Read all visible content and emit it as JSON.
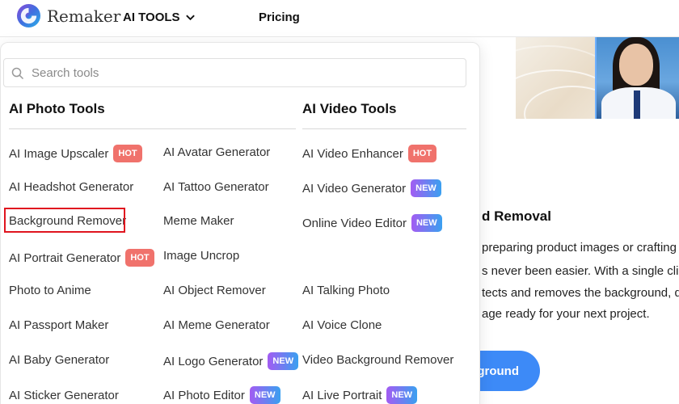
{
  "header": {
    "brand": "Remaker",
    "ai_tools_label": "AI TOOLS",
    "pricing_label": "Pricing"
  },
  "search": {
    "placeholder": "Search tools",
    "value": ""
  },
  "photo_tools": {
    "title": "AI Photo Tools",
    "col1": [
      {
        "label": "AI Image Upscaler",
        "badge": "HOT"
      },
      {
        "label": "AI Headshot Generator"
      },
      {
        "label": "Background Remover"
      },
      {
        "label": "AI Portrait Generator",
        "badge": "HOT"
      },
      {
        "label": "Photo to Anime"
      },
      {
        "label": "AI Passport Maker"
      },
      {
        "label": "AI Baby Generator"
      },
      {
        "label": "AI Sticker Generator"
      }
    ],
    "col2": [
      {
        "label": "AI Avatar Generator"
      },
      {
        "label": "AI Tattoo Generator"
      },
      {
        "label": "Meme Maker"
      },
      {
        "label": "Image Uncrop"
      },
      {
        "label": "AI Object Remover"
      },
      {
        "label": "AI Meme Generator"
      },
      {
        "label": "AI Logo Generator",
        "badge": "NEW"
      },
      {
        "label": "AI Photo Editor",
        "badge": "NEW"
      }
    ]
  },
  "video_tools": {
    "title": "AI Video Tools",
    "items": [
      {
        "label": "AI Video Enhancer",
        "badge": "HOT"
      },
      {
        "label": "AI Video Generator",
        "badge": "NEW"
      },
      {
        "label": "Online Video Editor",
        "badge": "NEW"
      },
      {
        "label": "AI Talking Photo"
      },
      {
        "label": "AI Voice Clone"
      },
      {
        "label": "Video Background Remover"
      },
      {
        "label": "AI Live Portrait",
        "badge": "NEW"
      }
    ]
  },
  "background_page": {
    "heading": "d Removal",
    "lines": [
      "preparing product images or crafting a",
      "s never been easier. With a single click",
      "tects and removes the background, de",
      "age ready for your next project."
    ],
    "button_label": "kground"
  },
  "colors": {
    "hot": "#f0726c",
    "new_start": "#a35cf2",
    "new_end": "#3aa0f0",
    "highlight": "#e0151f",
    "button": "#3d8af7"
  }
}
